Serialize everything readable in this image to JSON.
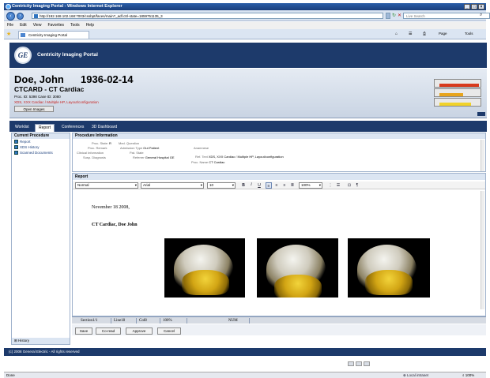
{
  "window": {
    "title": "Centricity Imaging Portal - Windows Internet Explorer"
  },
  "browser": {
    "url": "http://192.168.102.168:7003/cssbpt/faces/main?_adf.ctrl-state=1859751135_3",
    "search_placeholder": "Live Search",
    "menu": [
      "File",
      "Edit",
      "View",
      "Favorites",
      "Tools",
      "Help"
    ],
    "tab_label": "Centricity Imaging Portal",
    "command_items": [
      "Page",
      "Tools"
    ]
  },
  "portal": {
    "logo_text": "GE",
    "title": "Centricity Imaging Portal"
  },
  "patient": {
    "name": "Doe, John",
    "dob": "1936-02-14",
    "procedure": "CTCARD - CT Cardiac",
    "ids": "Proc. ID: 5398 Case ID: 3080",
    "description": "XDS, XXX Cardiac / Multiple HP, Layout/configuration",
    "open_images": "Open Images"
  },
  "status_colors": {
    "high": "#d83a1c",
    "mid": "#e8a51c",
    "low": "#f1d22a"
  },
  "main_tabs": [
    "Worklist",
    "Report",
    "Conferences",
    "3D Dashboard"
  ],
  "left_panel": {
    "title": "Current Procedure",
    "items": [
      "Report",
      "XDS History",
      "Scanned Documents"
    ],
    "history": "History"
  },
  "procedure_info": {
    "title": "Procedure Information",
    "proc_state_label": "Proc. State:",
    "proc_state_value": "R",
    "med_question_label": "Med. Question",
    "proc_remark_label": "Proc. Remark",
    "admission_type_label": "Admission Type",
    "admission_type_value": "Out Patient",
    "clinical_info_label": "Clinical Information",
    "pat_state_label": "Pat. State",
    "susp_diagnosis_label": "Susp. Diagnosis",
    "referrer_label": "Referrer",
    "referrer_value": "General Hospital GE",
    "anamnesis_label": "Anamnese",
    "ref_text_label": "Ref. Text",
    "ref_text_value": "XDS, XXX Cardiac / Multiple HP, Layout/configuration",
    "proc_name_label": "Proc. Name",
    "proc_name_value": "CT Cardiac"
  },
  "report": {
    "title": "Report",
    "style": "Normal",
    "font": "Arial",
    "size": "10",
    "zoom": "100%",
    "date_line": "November 18 2008,",
    "heading_a": "CT Cardiac,",
    "heading_b": "Doe John",
    "status": [
      "Section1/1",
      "Line18",
      "Col8",
      "100%",
      "NUM"
    ]
  },
  "action_buttons": [
    "Save",
    "Co-read",
    "Approve",
    "Cancel"
  ],
  "footer_text": "(c) 2008 General Electric - All rights reserved",
  "statusbar": {
    "left": "Done",
    "zone": "Local intranet",
    "zoom": "100%"
  }
}
